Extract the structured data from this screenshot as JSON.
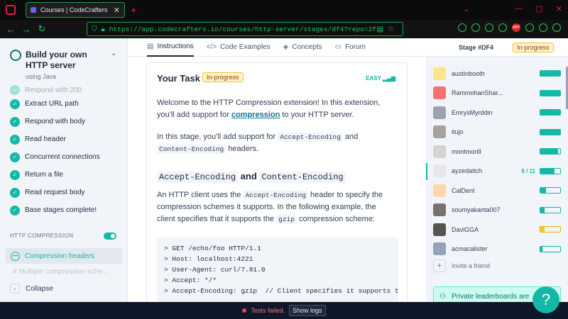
{
  "browser": {
    "tab_title": "Courses | CodeCrafters",
    "url": "https://app.codecrafters.io/courses/http-server/stages/df4?repo=2f29f97c-1df4-49b9-ba48-ebe"
  },
  "sidebar": {
    "course_title": "Build your own HTTP server",
    "course_subtitle": "using Java",
    "partial_stage": "Respond with 200",
    "stages": [
      "Extract URL path",
      "Respond with body",
      "Read header",
      "Concurrent connections",
      "Return a file",
      "Read request body",
      "Base stages complete!"
    ],
    "section_label": "HTTP COMPRESSION",
    "active_stage": "Compression headers",
    "next_stage": "Multiple compression sche...",
    "collapse_label": "Collapse"
  },
  "tabs": [
    "Instructions",
    "Code Examples",
    "Concepts",
    "Forum"
  ],
  "stage_id": "Stage #DF4",
  "status_badge": "In-progress",
  "task": {
    "title": "Your Task",
    "badge": "In-progress",
    "difficulty": "EASY",
    "p1_a": "Welcome to the HTTP Compression extension! In this extension, you'll add support for ",
    "p1_link": "compression",
    "p1_b": " to your HTTP server.",
    "p2_a": "In this stage, you'll add support for ",
    "p2_code1": "Accept-Encoding",
    "p2_b": " and ",
    "p2_code2": "Content-Encoding",
    "p2_c": " headers.",
    "h3_code1": "Accept-Encoding",
    "h3_and": " and ",
    "h3_code2": "Content-Encoding",
    "p3_a": "An HTTP client uses the ",
    "p3_code1": "Accept-Encoding",
    "p3_b": " header to specify the compression schemes it supports. In the following example, the client specifies that it supports the ",
    "p3_code2": "gzip",
    "p3_c": " compression scheme:",
    "code_lines": [
      "> GET /echo/foo HTTP/1.1",
      "> Host: localhost:4221",
      "> User-Agent: curl/7.81.0",
      "> Accept: */*",
      "> Accept-Encoding: gzip  // Client specifies it supports the gz"
    ]
  },
  "leaderboard": [
    {
      "name": "austinbooth",
      "score": "",
      "progress": 1.0,
      "color": "teal"
    },
    {
      "name": "RammohanShar...",
      "score": "",
      "progress": 1.0,
      "color": "teal"
    },
    {
      "name": "EmrysMyrddin",
      "score": "",
      "progress": 1.0,
      "color": "teal"
    },
    {
      "name": "itujo",
      "score": "",
      "progress": 1.0,
      "color": "teal"
    },
    {
      "name": "montmorill",
      "score": "",
      "progress": 0.9,
      "color": "teal"
    },
    {
      "name": "ayzedaitch",
      "score": "8 / 11",
      "progress": 0.73,
      "color": "teal",
      "highlight": true
    },
    {
      "name": "CalDent",
      "score": "",
      "progress": 0.3,
      "color": "teal"
    },
    {
      "name": "soumyakanta007",
      "score": "",
      "progress": 0.2,
      "color": "teal"
    },
    {
      "name": "DaviGGA",
      "score": "",
      "progress": 0.2,
      "color": "yellow"
    },
    {
      "name": "acmacalister",
      "score": "",
      "progress": 0.1,
      "color": "teal"
    }
  ],
  "invite_label": "Invite a friend",
  "private_label": "Private leaderboards are",
  "help_label": "?",
  "status_bar": {
    "tests_failed": "Tests failed.",
    "show_logs": "Show logs"
  },
  "colors": {
    "accent": "#14b8a6",
    "badge": "#fef3c7",
    "failed": "#ef4444"
  }
}
